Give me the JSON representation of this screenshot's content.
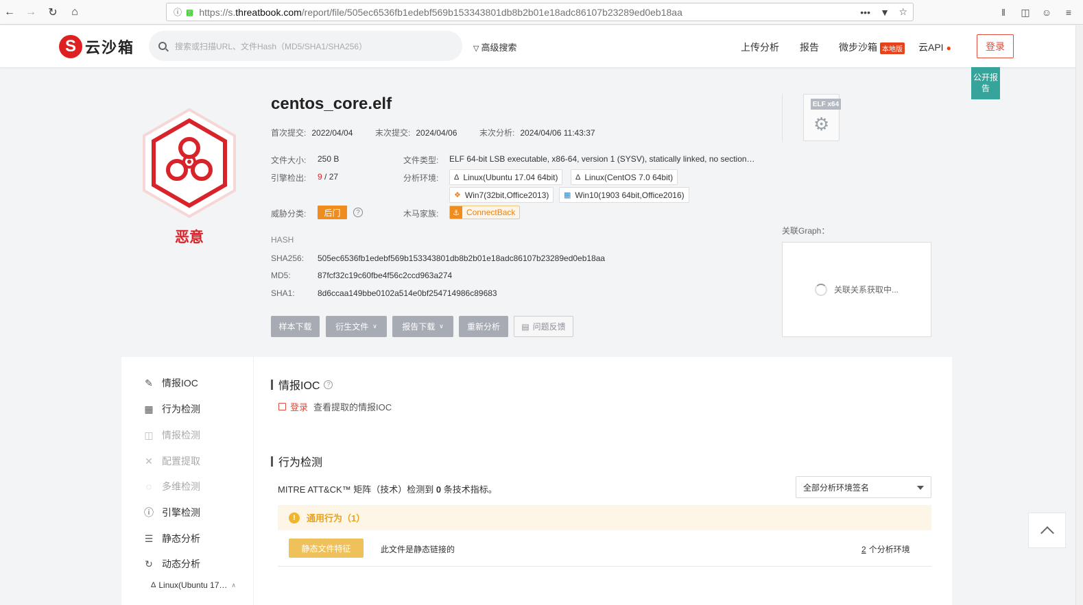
{
  "browser": {
    "url_prefix": "https://s.",
    "url_host": "threatbook.com",
    "url_path": "/report/file/505ec6536fb1edebf569b153343801db8b2b01e18adc86107b23289ed0eb18aa",
    "more_icon": "•••"
  },
  "header": {
    "logo_mark": "S",
    "logo_text": "云沙箱",
    "search_placeholder": "搜索或扫描URL、文件Hash（MD5/SHA1/SHA256）",
    "advanced_search": "高级搜索",
    "nav": {
      "upload": "上传分析",
      "report": "报告",
      "microstep": "微步沙箱",
      "local_badge": "本地版",
      "api": "云API"
    },
    "login": "登录",
    "public_report": "公开报告"
  },
  "verdict": {
    "label": "恶意",
    "color": "#d9232a"
  },
  "file": {
    "name": "centos_core.elf",
    "first_submit_label": "首次提交:",
    "first_submit": "2022/04/04",
    "last_submit_label": "末次提交:",
    "last_submit": "2024/04/06",
    "last_analysis_label": "末次分析:",
    "last_analysis": "2024/04/06 11:43:37",
    "size_label": "文件大小:",
    "size": "250 B",
    "engine_label": "引擎检出:",
    "engine_hits": "9",
    "engine_total": "/ 27",
    "type_label": "文件类型:",
    "type": "ELF 64-bit LSB executable, x86-64, version 1 (SYSV), statically linked, no section…",
    "env_label": "分析环境:",
    "envs": [
      "Linux(Ubuntu 17.04 64bit)",
      "Linux(CentOS 7.0 64bit)",
      "Win7(32bit,Office2013)",
      "Win10(1903 64bit,Office2016)"
    ],
    "threat_label": "威胁分类:",
    "threat": "后门",
    "family_label": "木马家族:",
    "family": "ConnectBack",
    "hash_heading": "HASH",
    "sha256_label": "SHA256:",
    "sha256": "505ec6536fb1edebf569b153343801db8b2b01e18adc86107b23289ed0eb18aa",
    "md5_label": "MD5:",
    "md5": "87fcf32c19c60fbe4f56c2ccd963a274",
    "sha1_label": "SHA1:",
    "sha1": "8d6ccaa149bbe0102a514e0bf254714986c89683"
  },
  "actions": {
    "download_sample": "样本下载",
    "derived_files": "衍生文件",
    "download_report": "报告下载",
    "reanalyze": "重新分析",
    "feedback": "问题反馈"
  },
  "graph": {
    "title": "关联Graph：",
    "loading": "关联关系获取中..."
  },
  "elf_icon": {
    "badge": "ELF x64"
  },
  "side_nav": {
    "items": [
      {
        "label": "情报IOC",
        "icon": "edit-icon",
        "disabled": false
      },
      {
        "label": "行为检测",
        "icon": "monitor-icon",
        "disabled": false
      },
      {
        "label": "情报检测",
        "icon": "layout-icon",
        "disabled": true
      },
      {
        "label": "配置提取",
        "icon": "tools-icon",
        "disabled": true
      },
      {
        "label": "多维检测",
        "icon": "scan-icon",
        "disabled": true
      },
      {
        "label": "引擎检测",
        "icon": "question-icon",
        "disabled": false
      },
      {
        "label": "静态分析",
        "icon": "list-icon",
        "disabled": false
      },
      {
        "label": "动态分析",
        "icon": "cycle-icon",
        "disabled": false
      }
    ],
    "sub_item": "Linux(Ubuntu 17…"
  },
  "ioc": {
    "title": "情报IOC",
    "login_link": "登录",
    "login_hint": "查看提取的情报IOC"
  },
  "behavior": {
    "title": "行为检测",
    "mitre_prefix": "MITRE ATT&CK™ 矩阵（技术）检测到 ",
    "mitre_count": "0",
    "mitre_suffix": " 条技术指标。",
    "env_select": "全部分析环境签名",
    "general_title": "通用行为（1）",
    "static_tag": "静态文件特征",
    "static_desc": "此文件是静态链接的",
    "env_count_num": "2",
    "env_count_suffix": "个分析环境"
  },
  "colors": {
    "brand_red": "#e02020",
    "threat_orange": "#f08c1e",
    "teal": "#36a49a"
  }
}
